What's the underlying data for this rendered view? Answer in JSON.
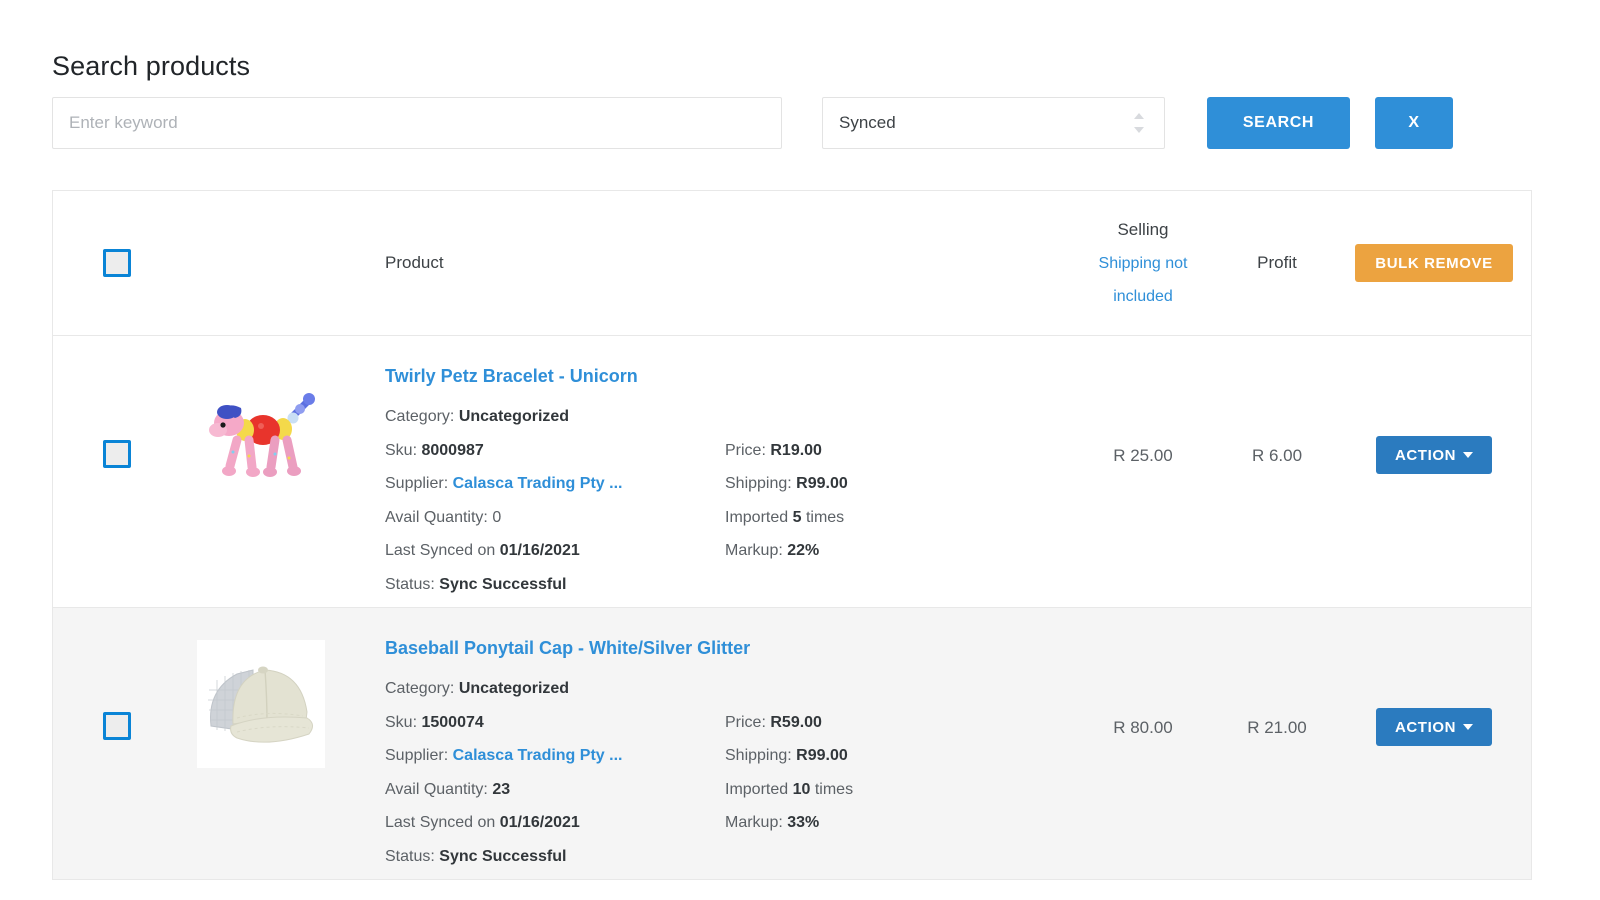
{
  "page": {
    "title": "Search products"
  },
  "search": {
    "keyword_value": "",
    "keyword_placeholder": "Enter keyword",
    "status_selected": "Synced",
    "search_label": "SEARCH",
    "clear_label": "X"
  },
  "table": {
    "header": {
      "product": "Product",
      "selling": "Selling",
      "selling_note": "Shipping not included",
      "profit": "Profit",
      "bulk_remove": "BULK REMOVE"
    },
    "labels": {
      "category": "Category:",
      "sku": "Sku:",
      "supplier": "Supplier:",
      "avail_quantity": "Avail Quantity:",
      "last_synced": "Last Synced on",
      "status": "Status:",
      "price": "Price:",
      "shipping": "Shipping:",
      "imported_prefix": "Imported",
      "imported_suffix": "times",
      "markup": "Markup:",
      "action": "ACTION"
    },
    "rows": [
      {
        "name": "Twirly Petz Bracelet - Unicorn",
        "category": "Uncategorized",
        "sku": "8000987",
        "supplier": "Calasca Trading Pty ...",
        "avail_quantity": "0",
        "last_synced": "01/16/2021",
        "status": "Sync Successful",
        "price": "R19.00",
        "shipping": "R99.00",
        "imported": "5",
        "markup": "22%",
        "selling": "R 25.00",
        "profit": "R 6.00",
        "image": "twirly-petz-unicorn-toy"
      },
      {
        "name": "Baseball Ponytail Cap - White/Silver Glitter",
        "category": "Uncategorized",
        "sku": "1500074",
        "supplier": "Calasca Trading Pty ...",
        "avail_quantity": "23",
        "last_synced": "01/16/2021",
        "status": "Sync Successful",
        "price": "R59.00",
        "shipping": "R99.00",
        "imported": "10",
        "markup": "33%",
        "selling": "R 80.00",
        "profit": "R 21.00",
        "image": "baseball-ponytail-cap"
      }
    ]
  },
  "colors": {
    "primary_blue": "#2f8fd8",
    "action_blue": "#2b7bbf",
    "bulk_orange": "#eca340",
    "checkbox_blue": "#0a84d6",
    "alt_row": "#f5f5f5"
  }
}
